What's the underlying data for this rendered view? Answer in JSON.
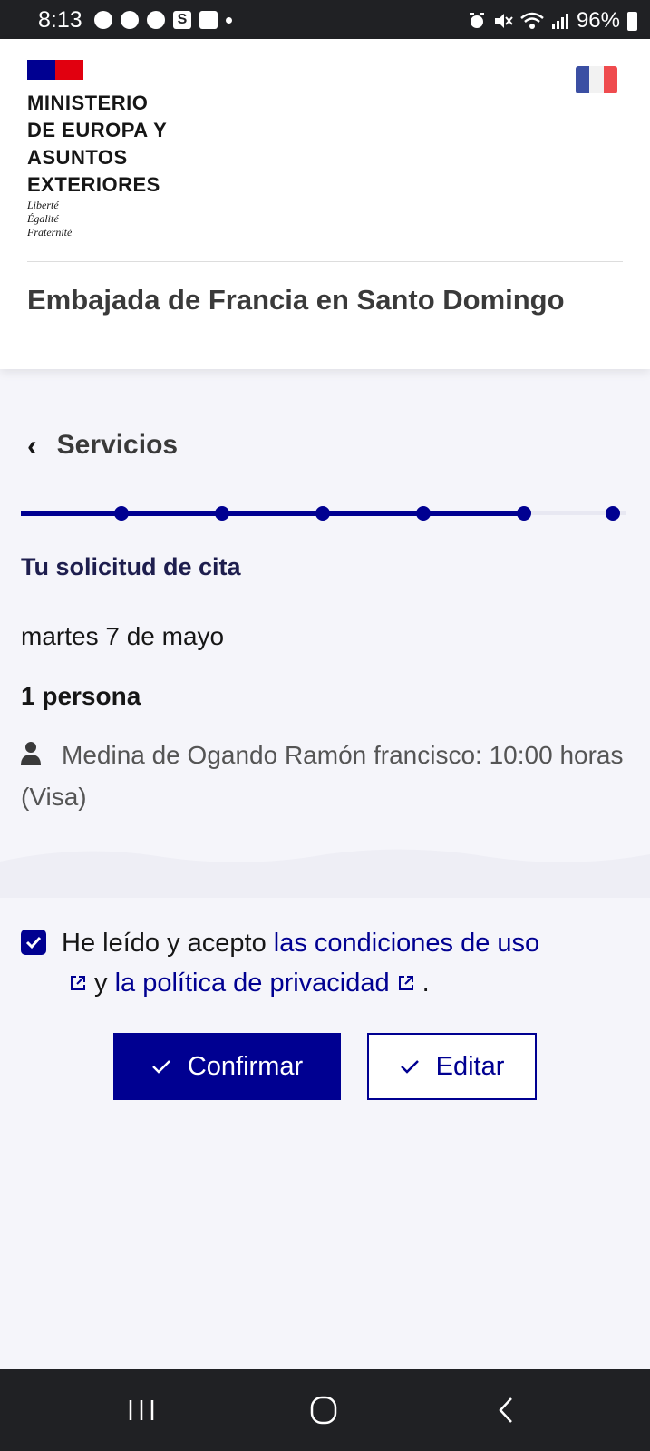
{
  "status_bar": {
    "time": "8:13",
    "battery": "96%",
    "left_icons": [
      "chat-bubble-icon",
      "whatsapp-icon",
      "messenger-icon",
      "s-app-icon",
      "gallery-icon",
      "dot-icon"
    ],
    "right_icons": [
      "alarm-icon",
      "mute-icon",
      "wifi-icon",
      "signal-icon",
      "battery-icon"
    ]
  },
  "header": {
    "ministry_lines": [
      "MINISTERIO",
      "DE EUROPA Y",
      "ASUNTOS",
      "EXTERIORES"
    ],
    "motto_lines": [
      "Liberté",
      "Égalité",
      "Fraternité"
    ],
    "embassy": "Embajada de Francia en Santo Domingo",
    "language_flag": "french-flag-icon"
  },
  "nav": {
    "back_label": "Servicios"
  },
  "stepper": {
    "total_steps": 7,
    "current_step": 6
  },
  "request": {
    "title": "Tu solicitud de cita",
    "date": "martes 7 de mayo",
    "persons": "1 persona",
    "person_line": "Medina de Ogando Ramón francisco: 10:00 horas (Visa)"
  },
  "consent": {
    "checked": true,
    "text_before": "He leído y acepto ",
    "link_terms": "las condiciones de uso",
    "text_middle": "y ",
    "link_privacy": "la política de privacidad",
    "text_after": "."
  },
  "buttons": {
    "confirm": "Confirmar",
    "edit": "Editar"
  },
  "colors": {
    "primary": "#000091",
    "status_bar": "#202124",
    "page_bg": "#f5f5fa"
  }
}
